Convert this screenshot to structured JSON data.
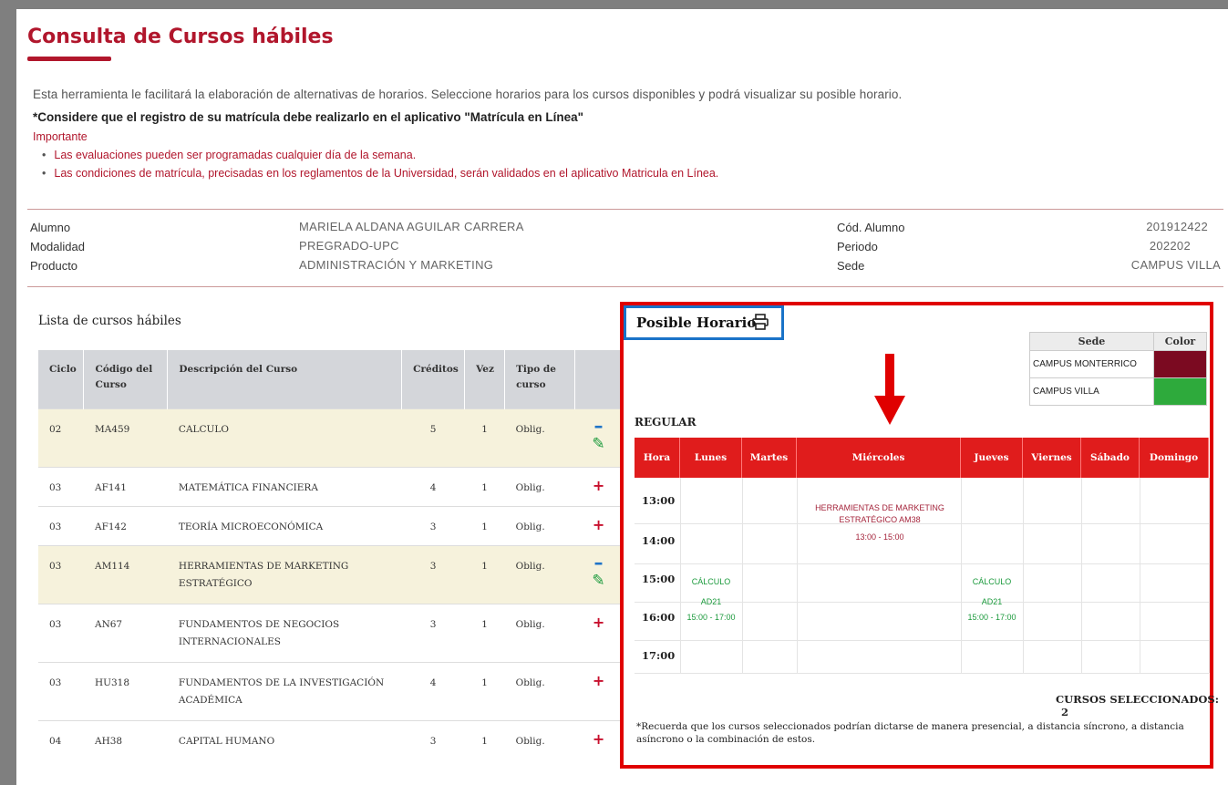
{
  "page": {
    "title": "Consulta de Cursos hábiles",
    "intro": "Esta herramienta le facilitará la elaboración de alternativas de horarios. Seleccione horarios para los cursos disponibles y podrá visualizar su posible horario.",
    "note": "*Considere que el registro de su matrícula debe realizarlo en el aplicativo \"Matrícula en Línea\"",
    "important_label": "Importante",
    "important_items": [
      "Las evaluaciones pueden ser programadas cualquier día de la semana.",
      "Las condiciones de matrícula, precisadas en los reglamentos de la Universidad, serán validados en el aplicativo Matricula en Línea."
    ]
  },
  "student": {
    "alumno_label": "Alumno",
    "alumno": "MARIELA ALDANA AGUILAR CARRERA",
    "modalidad_label": "Modalidad",
    "modalidad": "PREGRADO-UPC",
    "producto_label": "Producto",
    "producto": "ADMINISTRACIÓN Y MARKETING",
    "cod_label": "Cód. Alumno",
    "cod": "201912422",
    "periodo_label": "Periodo",
    "periodo": "202202",
    "sede_label": "Sede",
    "sede": "CAMPUS VILLA"
  },
  "courses": {
    "title": "Lista de cursos hábiles",
    "headers": [
      "Ciclo",
      "Código del Curso",
      "Descripción del Curso",
      "Créditos",
      "Vez",
      "Tipo de curso"
    ],
    "rows": [
      {
        "ciclo": "02",
        "codigo": "MA459",
        "desc": "CALCULO",
        "creditos": "5",
        "vez": "1",
        "tipo": "Oblig.",
        "selected": true
      },
      {
        "ciclo": "03",
        "codigo": "AF141",
        "desc": "MATEMÁTICA FINANCIERA",
        "creditos": "4",
        "vez": "1",
        "tipo": "Oblig.",
        "selected": false
      },
      {
        "ciclo": "03",
        "codigo": "AF142",
        "desc": "TEORÍA MICROECONÓMICA",
        "creditos": "3",
        "vez": "1",
        "tipo": "Oblig.",
        "selected": false
      },
      {
        "ciclo": "03",
        "codigo": "AM114",
        "desc": "HERRAMIENTAS DE MARKETING ESTRATÉGICO",
        "creditos": "3",
        "vez": "1",
        "tipo": "Oblig.",
        "selected": true
      },
      {
        "ciclo": "03",
        "codigo": "AN67",
        "desc": "FUNDAMENTOS DE NEGOCIOS INTERNACIONALES",
        "creditos": "3",
        "vez": "1",
        "tipo": "Oblig.",
        "selected": false
      },
      {
        "ciclo": "03",
        "codigo": "HU318",
        "desc": "FUNDAMENTOS DE LA INVESTIGACIÓN ACADÉMICA",
        "creditos": "4",
        "vez": "1",
        "tipo": "Oblig.",
        "selected": false
      },
      {
        "ciclo": "04",
        "codigo": "AH38",
        "desc": "CAPITAL HUMANO",
        "creditos": "3",
        "vez": "1",
        "tipo": "Oblig.",
        "selected": false
      }
    ]
  },
  "horario": {
    "title": "Posible Horario",
    "icon": "printer-icon",
    "sede_header": "Sede",
    "color_header": "Color",
    "sedes": [
      {
        "name": "CAMPUS MONTERRICO",
        "color": "#7b0a21"
      },
      {
        "name": "CAMPUS VILLA",
        "color": "#2eaa3c"
      }
    ],
    "regular_label": "REGULAR",
    "days": [
      "Hora",
      "Lunes",
      "Martes",
      "Miércoles",
      "Jueves",
      "Viernes",
      "Sábado",
      "Domingo"
    ],
    "hours": [
      "13:00",
      "14:00",
      "15:00",
      "16:00",
      "17:00"
    ],
    "events": {
      "miercoles_name": "HERRAMIENTAS DE MARKETING ESTRATÉGICO AM38",
      "miercoles_time": "13:00 - 15:00",
      "lunes_name": "CÁLCULO",
      "lunes_room": "AD21",
      "lunes_time": "15:00 - 17:00",
      "jueves_name": "CÁLCULO",
      "jueves_room": "AD21",
      "jueves_time": "15:00 - 17:00"
    },
    "selected_label": "CURSOS SELECCIONADOS:",
    "selected_count": "2",
    "footnote": "*Recuerda que los cursos seleccionados podrían dictarse de manera presencial, a distancia síncrono, a distancia asíncrono o la combinación de estos."
  },
  "colors": {
    "brand_red": "#b1162c",
    "header_red": "#e01c1c",
    "selected_row": "#f6f2dc",
    "highlight_red": "#e00000",
    "highlight_blue": "#1a73c8"
  }
}
